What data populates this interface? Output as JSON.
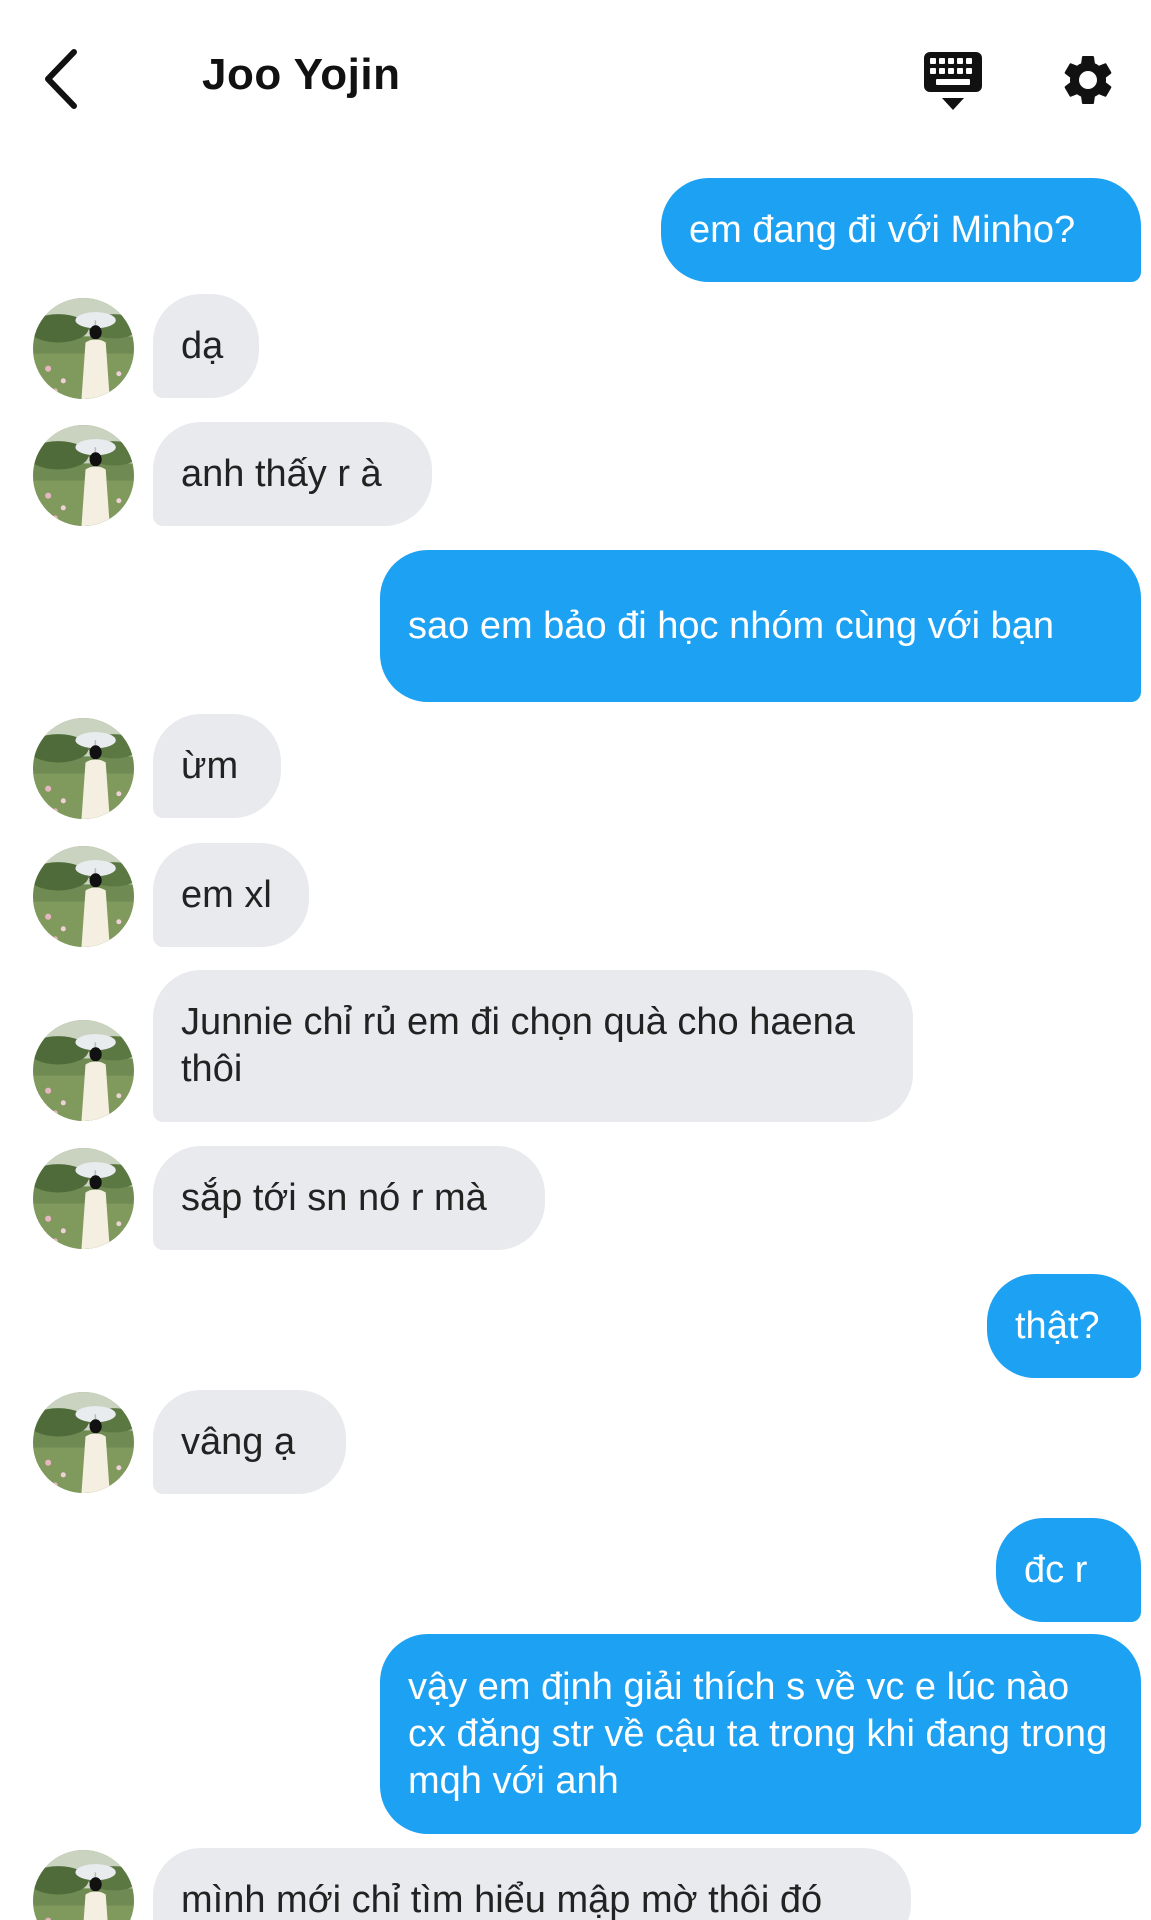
{
  "header": {
    "title": "Joo Yojin",
    "back_icon": "chevron-left-icon",
    "keyboard_icon": "keyboard-icon",
    "settings_icon": "gear-icon"
  },
  "colors": {
    "outgoing_bubble": "#1da1f2",
    "incoming_bubble": "#e8eaed"
  },
  "messages": [
    {
      "side": "out",
      "text": "em đang đi với Minho?"
    },
    {
      "side": "in",
      "text": "dạ"
    },
    {
      "side": "in",
      "text": "anh thấy r à"
    },
    {
      "side": "out",
      "text": "sao em bảo đi học nhóm cùng với bạn"
    },
    {
      "side": "in",
      "text": "ừm"
    },
    {
      "side": "in",
      "text": "em xl"
    },
    {
      "side": "in",
      "text": "Junnie chỉ rủ em đi chọn quà cho haena thôi"
    },
    {
      "side": "in",
      "text": "sắp tới sn nó r mà"
    },
    {
      "side": "out",
      "text": "thật?"
    },
    {
      "side": "in",
      "text": "vâng ạ"
    },
    {
      "side": "out",
      "text": "đc r"
    },
    {
      "side": "out",
      "text": "vậy em định giải thích s về vc e lúc nào cx đăng str về cậu ta trong khi đang trong mqh với anh"
    },
    {
      "side": "in",
      "text": "mình mới chỉ tìm hiểu mập mờ thôi đó"
    }
  ]
}
